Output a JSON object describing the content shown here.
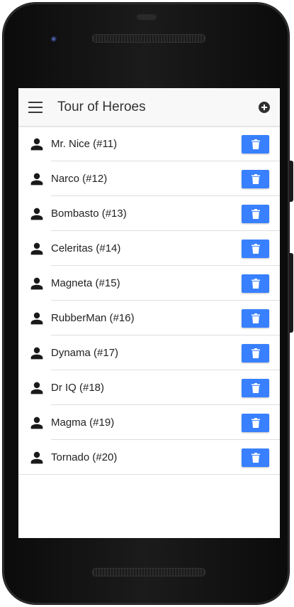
{
  "app": {
    "title": "Tour of Heroes"
  },
  "toolbar": {
    "menu_icon": "menu-icon",
    "add_icon": "add-circle-icon"
  },
  "heroes": [
    {
      "label": "Mr. Nice (#11)",
      "icon": "person-icon"
    },
    {
      "label": "Narco (#12)",
      "icon": "person-icon"
    },
    {
      "label": "Bombasto (#13)",
      "icon": "person-icon"
    },
    {
      "label": "Celeritas (#14)",
      "icon": "person-icon"
    },
    {
      "label": "Magneta (#15)",
      "icon": "person-icon"
    },
    {
      "label": "RubberMan (#16)",
      "icon": "person-icon"
    },
    {
      "label": "Dynama (#17)",
      "icon": "person-icon"
    },
    {
      "label": "Dr IQ (#18)",
      "icon": "person-icon"
    },
    {
      "label": "Magma (#19)",
      "icon": "person-icon"
    },
    {
      "label": "Tornado (#20)",
      "icon": "person-icon"
    }
  ],
  "colors": {
    "accent": "#3880ff",
    "toolbar_bg": "#f8f8f8",
    "text": "#222222"
  }
}
